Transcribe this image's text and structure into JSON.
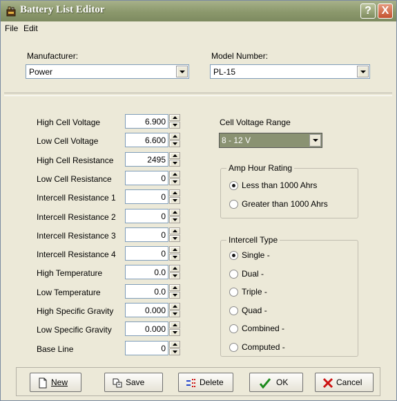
{
  "window": {
    "title": "Battery List Editor",
    "help": "?",
    "close": "X"
  },
  "menu": [
    "File",
    "Edit"
  ],
  "manufacturer": {
    "label": "Manufacturer:",
    "value": "Power"
  },
  "model": {
    "label": "Model Number:",
    "value": "PL-15"
  },
  "fields": [
    {
      "label": "High Cell Voltage",
      "value": "6.900"
    },
    {
      "label": "Low Cell Voltage",
      "value": "6.600"
    },
    {
      "label": "High Cell Resistance",
      "value": "2495"
    },
    {
      "label": "Low Cell Resistance",
      "value": "0"
    },
    {
      "label": "Intercell Resistance 1",
      "value": "0"
    },
    {
      "label": "Intercell Resistance 2",
      "value": "0"
    },
    {
      "label": "Intercell Resistance 3",
      "value": "0"
    },
    {
      "label": "Intercell Resistance 4",
      "value": "0"
    },
    {
      "label": "High Temperature",
      "value": "0.0"
    },
    {
      "label": "Low Temperature",
      "value": "0.0"
    },
    {
      "label": "High Specific Gravity",
      "value": "0.000"
    },
    {
      "label": "Low Specific Gravity",
      "value": "0.000"
    },
    {
      "label": "Base Line",
      "value": "0"
    }
  ],
  "cell_voltage_range": {
    "label": "Cell Voltage Range",
    "value": "8 - 12 V",
    "bg": "#8a9272"
  },
  "amp_hour": {
    "title": "Amp Hour Rating",
    "options": [
      {
        "label": "Less than 1000 Ahrs",
        "selected": true
      },
      {
        "label": "Greater than 1000 Ahrs",
        "selected": false
      }
    ]
  },
  "intercell": {
    "title": "Intercell Type",
    "options": [
      {
        "label": "Single  -",
        "selected": true
      },
      {
        "label": "Dual  -",
        "selected": false
      },
      {
        "label": "Triple  -",
        "selected": false
      },
      {
        "label": "Quad  -",
        "selected": false
      },
      {
        "label": "Combined  -",
        "selected": false
      },
      {
        "label": "Computed  -",
        "selected": false
      }
    ]
  },
  "buttons": {
    "new": "New",
    "save": "Save",
    "delete": "Delete",
    "ok": "OK",
    "cancel": "Cancel"
  },
  "colors": {
    "titlebar": "#8b986c",
    "window": "#ece9d8",
    "ok_green": "#1c8a1c",
    "cancel_red": "#cc1111"
  }
}
